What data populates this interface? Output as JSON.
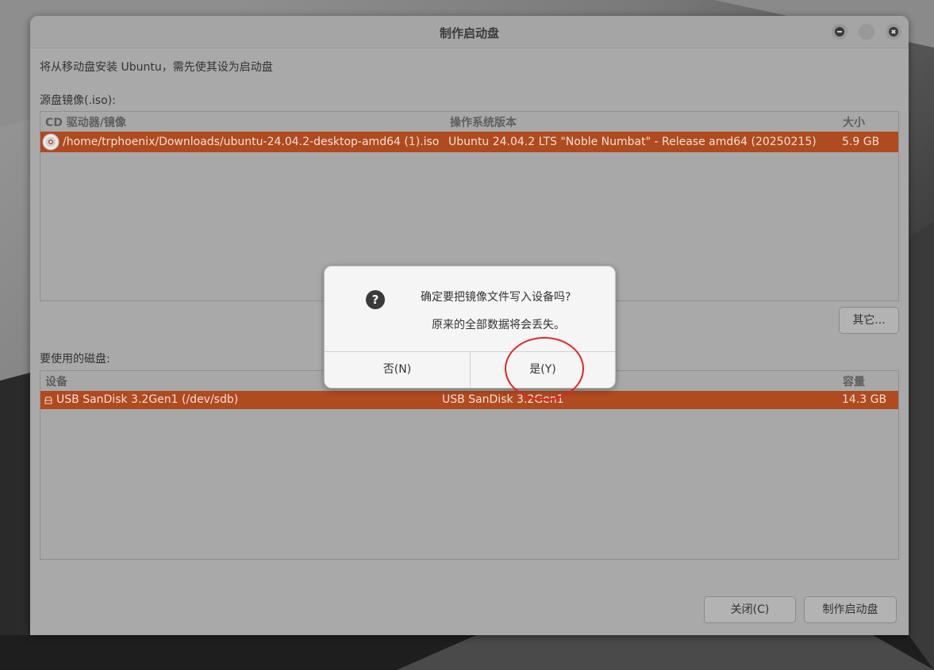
{
  "window": {
    "title": "制作启动盘"
  },
  "intro_text": "将从移动盘安装 Ubuntu，需先使其设为启动盘",
  "source": {
    "label": "源盘镜像(.iso):",
    "columns": [
      "CD 驱动器/镜像",
      "操作系统版本",
      "大小"
    ],
    "rows": [
      {
        "image": "/home/trphoenix/Downloads/ubuntu-24.04.2-desktop-amd64 (1).iso",
        "version": "Ubuntu 24.04.2 LTS \"Noble Numbat\" - Release amd64 (20250215)",
        "size": "5.9 GB",
        "icon": "cd-disc-icon"
      }
    ],
    "other_button": "其它..."
  },
  "disk": {
    "label": "要使用的磁盘:",
    "columns": [
      "设备",
      "容量"
    ],
    "rows": [
      {
        "device": "USB SanDisk 3.2Gen1 (/dev/sdb)",
        "label": "USB SanDisk 3.2Gen1",
        "capacity": "14.3 GB",
        "icon": "usb-drive-icon"
      }
    ]
  },
  "buttons": {
    "close": "关闭(C)",
    "make": "制作启动盘"
  },
  "dialog": {
    "line1": "确定要把镜像文件写入设备吗?",
    "line2": "原来的全部数据将会丢失。",
    "no": "否(N)",
    "yes": "是(Y)",
    "icon": "question-icon"
  },
  "colors": {
    "selection": "#b04a1f",
    "annotation": "#e02626"
  }
}
